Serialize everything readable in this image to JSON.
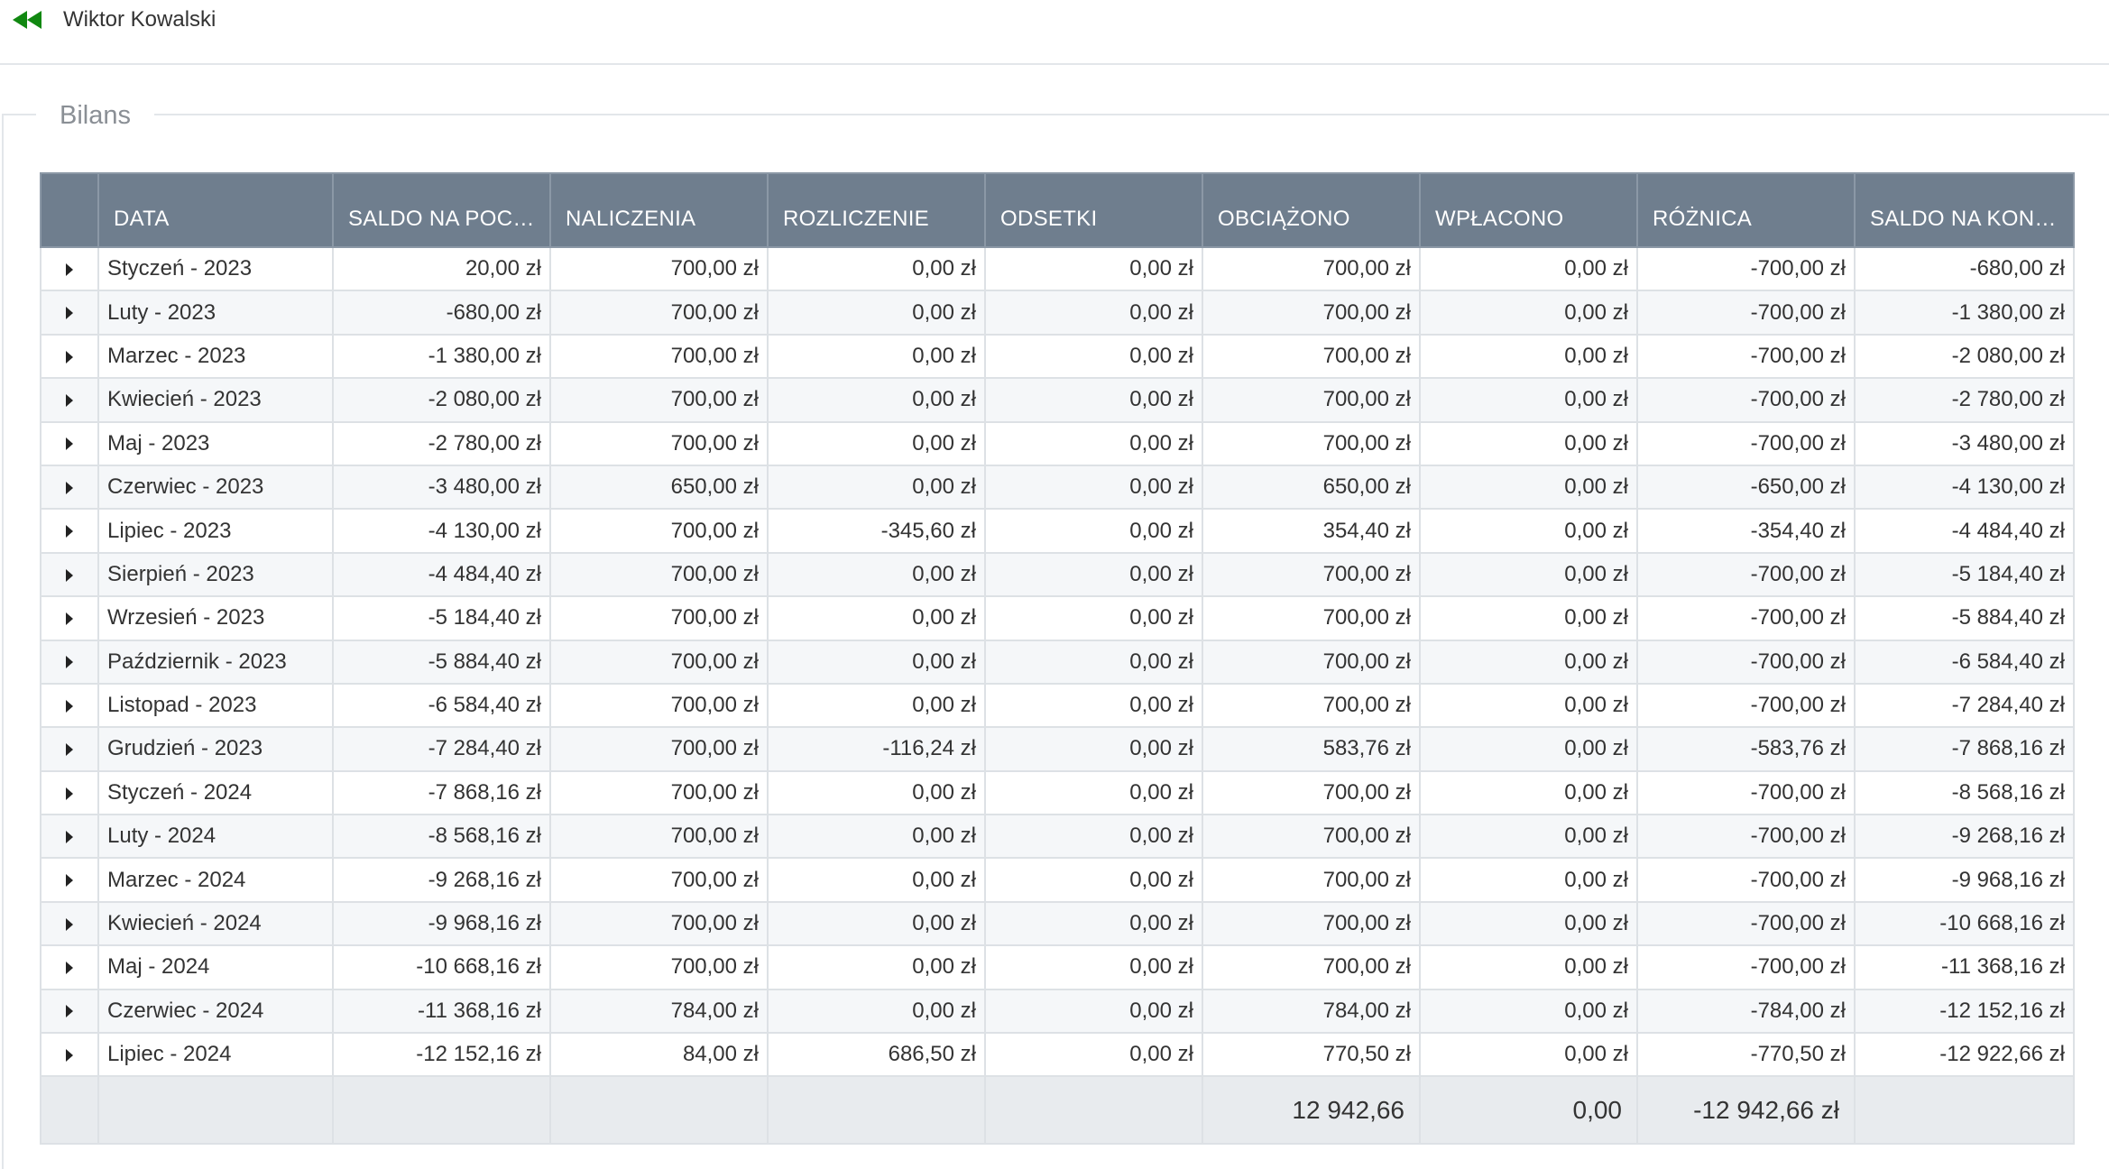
{
  "header": {
    "back_icon": "double-chevron-left-icon",
    "back_icon_color": "#118811",
    "user_name": "Wiktor Kowalski"
  },
  "section": {
    "title": "Bilans"
  },
  "table": {
    "header_color": "#6f7e8e",
    "columns": [
      "DATA",
      "SALDO NA POCZ...",
      "NALICZENIA",
      "ROZLICZENIE",
      "ODSETKI",
      "OBCIĄŻONO",
      "WPŁACONO",
      "RÓŻNICA",
      "SALDO NA KONI..."
    ],
    "rows": [
      {
        "date": "Styczeń - 2023",
        "saldo_start": "20,00 zł",
        "naliczenia": "700,00 zł",
        "rozliczenie": "0,00 zł",
        "odsetki": "0,00 zł",
        "obciazono": "700,00 zł",
        "wplacono": "0,00 zł",
        "roznica": "-700,00 zł",
        "saldo_end": "-680,00 zł"
      },
      {
        "date": "Luty - 2023",
        "saldo_start": "-680,00 zł",
        "naliczenia": "700,00 zł",
        "rozliczenie": "0,00 zł",
        "odsetki": "0,00 zł",
        "obciazono": "700,00 zł",
        "wplacono": "0,00 zł",
        "roznica": "-700,00 zł",
        "saldo_end": "-1 380,00 zł"
      },
      {
        "date": "Marzec - 2023",
        "saldo_start": "-1 380,00 zł",
        "naliczenia": "700,00 zł",
        "rozliczenie": "0,00 zł",
        "odsetki": "0,00 zł",
        "obciazono": "700,00 zł",
        "wplacono": "0,00 zł",
        "roznica": "-700,00 zł",
        "saldo_end": "-2 080,00 zł"
      },
      {
        "date": "Kwiecień - 2023",
        "saldo_start": "-2 080,00 zł",
        "naliczenia": "700,00 zł",
        "rozliczenie": "0,00 zł",
        "odsetki": "0,00 zł",
        "obciazono": "700,00 zł",
        "wplacono": "0,00 zł",
        "roznica": "-700,00 zł",
        "saldo_end": "-2 780,00 zł"
      },
      {
        "date": "Maj - 2023",
        "saldo_start": "-2 780,00 zł",
        "naliczenia": "700,00 zł",
        "rozliczenie": "0,00 zł",
        "odsetki": "0,00 zł",
        "obciazono": "700,00 zł",
        "wplacono": "0,00 zł",
        "roznica": "-700,00 zł",
        "saldo_end": "-3 480,00 zł"
      },
      {
        "date": "Czerwiec - 2023",
        "saldo_start": "-3 480,00 zł",
        "naliczenia": "650,00 zł",
        "rozliczenie": "0,00 zł",
        "odsetki": "0,00 zł",
        "obciazono": "650,00 zł",
        "wplacono": "0,00 zł",
        "roznica": "-650,00 zł",
        "saldo_end": "-4 130,00 zł"
      },
      {
        "date": "Lipiec - 2023",
        "saldo_start": "-4 130,00 zł",
        "naliczenia": "700,00 zł",
        "rozliczenie": "-345,60 zł",
        "odsetki": "0,00 zł",
        "obciazono": "354,40 zł",
        "wplacono": "0,00 zł",
        "roznica": "-354,40 zł",
        "saldo_end": "-4 484,40 zł"
      },
      {
        "date": "Sierpień - 2023",
        "saldo_start": "-4 484,40 zł",
        "naliczenia": "700,00 zł",
        "rozliczenie": "0,00 zł",
        "odsetki": "0,00 zł",
        "obciazono": "700,00 zł",
        "wplacono": "0,00 zł",
        "roznica": "-700,00 zł",
        "saldo_end": "-5 184,40 zł"
      },
      {
        "date": "Wrzesień - 2023",
        "saldo_start": "-5 184,40 zł",
        "naliczenia": "700,00 zł",
        "rozliczenie": "0,00 zł",
        "odsetki": "0,00 zł",
        "obciazono": "700,00 zł",
        "wplacono": "0,00 zł",
        "roznica": "-700,00 zł",
        "saldo_end": "-5 884,40 zł"
      },
      {
        "date": "Październik - 2023",
        "saldo_start": "-5 884,40 zł",
        "naliczenia": "700,00 zł",
        "rozliczenie": "0,00 zł",
        "odsetki": "0,00 zł",
        "obciazono": "700,00 zł",
        "wplacono": "0,00 zł",
        "roznica": "-700,00 zł",
        "saldo_end": "-6 584,40 zł"
      },
      {
        "date": "Listopad - 2023",
        "saldo_start": "-6 584,40 zł",
        "naliczenia": "700,00 zł",
        "rozliczenie": "0,00 zł",
        "odsetki": "0,00 zł",
        "obciazono": "700,00 zł",
        "wplacono": "0,00 zł",
        "roznica": "-700,00 zł",
        "saldo_end": "-7 284,40 zł"
      },
      {
        "date": "Grudzień - 2023",
        "saldo_start": "-7 284,40 zł",
        "naliczenia": "700,00 zł",
        "rozliczenie": "-116,24 zł",
        "odsetki": "0,00 zł",
        "obciazono": "583,76 zł",
        "wplacono": "0,00 zł",
        "roznica": "-583,76 zł",
        "saldo_end": "-7 868,16 zł"
      },
      {
        "date": "Styczeń - 2024",
        "saldo_start": "-7 868,16 zł",
        "naliczenia": "700,00 zł",
        "rozliczenie": "0,00 zł",
        "odsetki": "0,00 zł",
        "obciazono": "700,00 zł",
        "wplacono": "0,00 zł",
        "roznica": "-700,00 zł",
        "saldo_end": "-8 568,16 zł"
      },
      {
        "date": "Luty - 2024",
        "saldo_start": "-8 568,16 zł",
        "naliczenia": "700,00 zł",
        "rozliczenie": "0,00 zł",
        "odsetki": "0,00 zł",
        "obciazono": "700,00 zł",
        "wplacono": "0,00 zł",
        "roznica": "-700,00 zł",
        "saldo_end": "-9 268,16 zł"
      },
      {
        "date": "Marzec - 2024",
        "saldo_start": "-9 268,16 zł",
        "naliczenia": "700,00 zł",
        "rozliczenie": "0,00 zł",
        "odsetki": "0,00 zł",
        "obciazono": "700,00 zł",
        "wplacono": "0,00 zł",
        "roznica": "-700,00 zł",
        "saldo_end": "-9 968,16 zł"
      },
      {
        "date": "Kwiecień - 2024",
        "saldo_start": "-9 968,16 zł",
        "naliczenia": "700,00 zł",
        "rozliczenie": "0,00 zł",
        "odsetki": "0,00 zł",
        "obciazono": "700,00 zł",
        "wplacono": "0,00 zł",
        "roznica": "-700,00 zł",
        "saldo_end": "-10 668,16 zł"
      },
      {
        "date": "Maj - 2024",
        "saldo_start": "-10 668,16 zł",
        "naliczenia": "700,00 zł",
        "rozliczenie": "0,00 zł",
        "odsetki": "0,00 zł",
        "obciazono": "700,00 zł",
        "wplacono": "0,00 zł",
        "roznica": "-700,00 zł",
        "saldo_end": "-11 368,16 zł"
      },
      {
        "date": "Czerwiec - 2024",
        "saldo_start": "-11 368,16 zł",
        "naliczenia": "784,00 zł",
        "rozliczenie": "0,00 zł",
        "odsetki": "0,00 zł",
        "obciazono": "784,00 zł",
        "wplacono": "0,00 zł",
        "roznica": "-784,00 zł",
        "saldo_end": "-12 152,16 zł"
      },
      {
        "date": "Lipiec - 2024",
        "saldo_start": "-12 152,16 zł",
        "naliczenia": "84,00 zł",
        "rozliczenie": "686,50 zł",
        "odsetki": "0,00 zł",
        "obciazono": "770,50 zł",
        "wplacono": "0,00 zł",
        "roznica": "-770,50 zł",
        "saldo_end": "-12 922,66 zł"
      }
    ],
    "footer": {
      "obciazono": "12 942,66",
      "wplacono": "0,00",
      "roznica": "-12 942,66 zł"
    }
  }
}
